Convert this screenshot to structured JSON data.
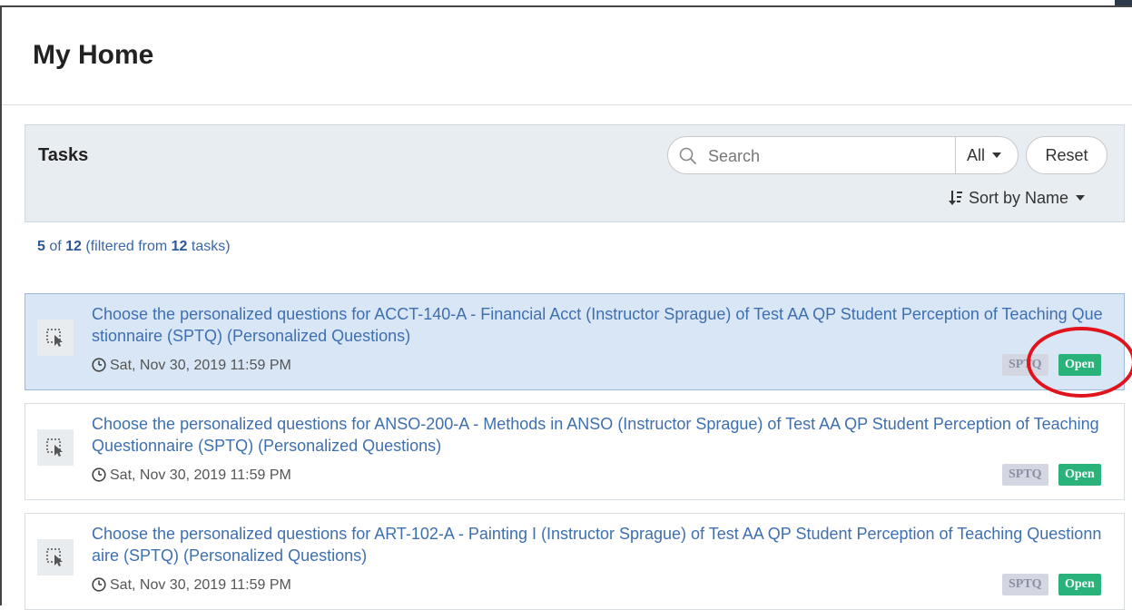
{
  "header": {
    "title": "My Home"
  },
  "tasks_panel": {
    "title": "Tasks",
    "search": {
      "placeholder": "Search",
      "value": ""
    },
    "filter": {
      "selected": "All"
    },
    "reset_label": "Reset",
    "sort_label": "Sort by Name"
  },
  "summary": {
    "shown": "5",
    "of_text": "of",
    "total": "12",
    "filtered_prefix": "(filtered from",
    "filtered_total": "12",
    "filtered_suffix": "tasks)"
  },
  "tasks": [
    {
      "title": "Choose the personalized questions for ACCT-140-A - Financial Acct (Instructor Sprague) of Test AA QP Student Perception of Teaching Questionnaire (SPTQ) (Personalized Questions)",
      "due": "Sat, Nov 30, 2019 11:59 PM",
      "type_badge": "SPTQ",
      "status_badge": "Open"
    },
    {
      "title": "Choose the personalized questions for ANSO-200-A - Methods in ANSO (Instructor Sprague) of Test AA QP Student Perception of Teaching Questionnaire (SPTQ) (Personalized Questions)",
      "due": "Sat, Nov 30, 2019 11:59 PM",
      "type_badge": "SPTQ",
      "status_badge": "Open"
    },
    {
      "title": "Choose the personalized questions for ART-102-A - Painting I (Instructor Sprague) of Test AA QP Student Perception of Teaching Questionnaire (SPTQ) (Personalized Questions)",
      "due": "Sat, Nov 30, 2019 11:59 PM",
      "type_badge": "SPTQ",
      "status_badge": "Open"
    }
  ],
  "colors": {
    "link": "#3e6fb0",
    "active_row": "#d9e6f5",
    "open_badge": "#2ab27b",
    "sptq_badge": "#d4d7e2",
    "highlight_ellipse": "#e0141c"
  }
}
